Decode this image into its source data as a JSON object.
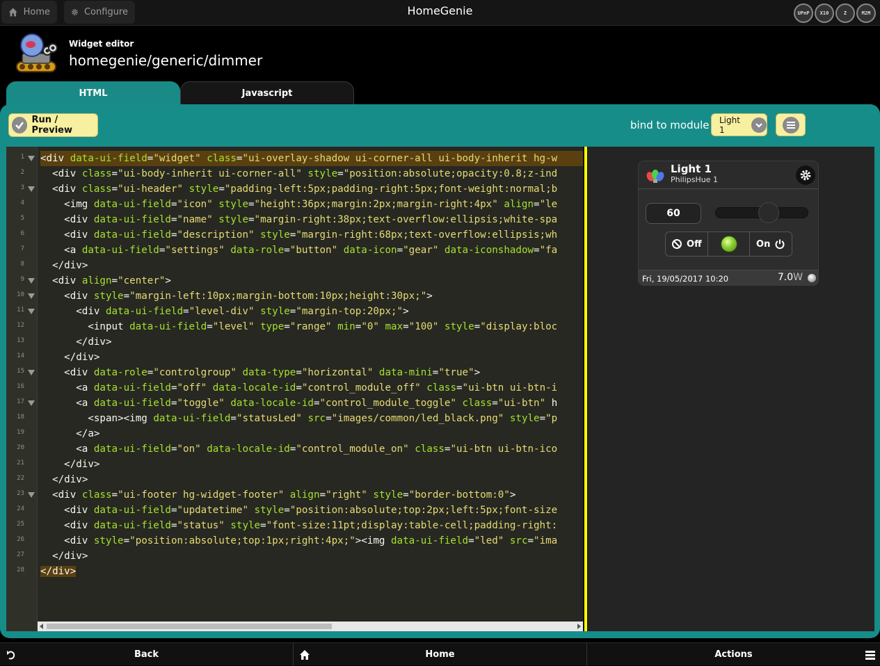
{
  "app": {
    "title": "HomeGenie"
  },
  "topbar": {
    "home_label": "Home",
    "configure_label": "Configure",
    "logos": [
      "UPnP",
      "X10",
      "Z",
      "M2M"
    ]
  },
  "header": {
    "subtitle": "Widget editor",
    "title": "homegenie/generic/dimmer"
  },
  "tabs": [
    {
      "label": "HTML",
      "active": true
    },
    {
      "label": "Javascript",
      "active": false
    }
  ],
  "toolbar": {
    "run_label": "Run / Preview",
    "bind_label": "bind to module",
    "bind_value": "Light 1"
  },
  "editor": {
    "line_numbers": [
      "1",
      "2",
      "3",
      "4",
      "5",
      "6",
      "7",
      "8",
      "9",
      "10",
      "11",
      "12",
      "13",
      "14",
      "15",
      "16",
      "17",
      "18",
      "19",
      "20",
      "21",
      "22",
      "23",
      "24",
      "25",
      "26",
      "27",
      "28"
    ],
    "lines": [
      "<div data-ui-field=\"widget\" class=\"ui-overlay-shadow ui-corner-all ui-body-inherit hg-w",
      "  <div class=\"ui-body-inherit ui-corner-all\" style=\"position:absolute;opacity:0.8;z-ind",
      "  <div class=\"ui-header\" style=\"padding-left:5px;padding-right:5px;font-weight:normal;b",
      "    <img data-ui-field=\"icon\" style=\"height:36px;margin:2px;margin-right:4px\" align=\"le",
      "    <div data-ui-field=\"name\" style=\"margin-right:38px;text-overflow:ellipsis;white-spa",
      "    <div data-ui-field=\"description\" style=\"margin-right:68px;text-overflow:ellipsis;wh",
      "    <a data-ui-field=\"settings\" data-role=\"button\" data-icon=\"gear\" data-iconshadow=\"fa",
      "  </div>",
      "  <div align=\"center\">",
      "    <div style=\"margin-left:10px;margin-bottom:10px;height:30px;\">",
      "      <div data-ui-field=\"level-div\" style=\"margin-top:20px;\">",
      "        <input data-ui-field=\"level\" type=\"range\" min=\"0\" max=\"100\" style=\"display:bloc",
      "      </div>",
      "    </div>",
      "    <div data-role=\"controlgroup\" data-type=\"horizontal\" data-mini=\"true\">",
      "      <a data-ui-field=\"off\" data-locale-id=\"control_module_off\" class=\"ui-btn ui-btn-i",
      "      <a data-ui-field=\"toggle\" data-locale-id=\"control_module_toggle\" class=\"ui-btn\" h",
      "        <span><img data-ui-field=\"statusLed\" src=\"images/common/led_black.png\" style=\"p",
      "      </a>",
      "      <a data-ui-field=\"on\" data-locale-id=\"control_module_on\" class=\"ui-btn ui-btn-ico",
      "    </div>",
      "  </div>",
      "  <div class=\"ui-footer hg-widget-footer\" align=\"right\" style=\"border-bottom:0\">",
      "    <div data-ui-field=\"updatetime\" style=\"position:absolute;top:2px;left:5px;font-size",
      "    <div data-ui-field=\"status\" style=\"font-size:11pt;display:table-cell;padding-right:",
      "    <div style=\"position:absolute;top:1px;right:4px;\"><img data-ui-field=\"led\" src=\"ima",
      "  </div>",
      "</div>"
    ],
    "fold_markers": [
      1,
      3,
      9,
      10,
      11,
      15,
      17,
      23
    ]
  },
  "widget": {
    "name": "Light 1",
    "description": "PhilipsHue 1",
    "level": "60",
    "level_fraction": 0.6,
    "off_label": "Off",
    "on_label": "On",
    "updated": "Fri, 19/05/2017 10:20",
    "power_value": "7.0",
    "power_unit": "W"
  },
  "bottombar": {
    "back_label": "Back",
    "home_label": "Home",
    "actions_label": "Actions"
  },
  "colors": {
    "accent": "#178d89",
    "button_bg": "#f6f0a0",
    "splitter": "#ffff00"
  }
}
